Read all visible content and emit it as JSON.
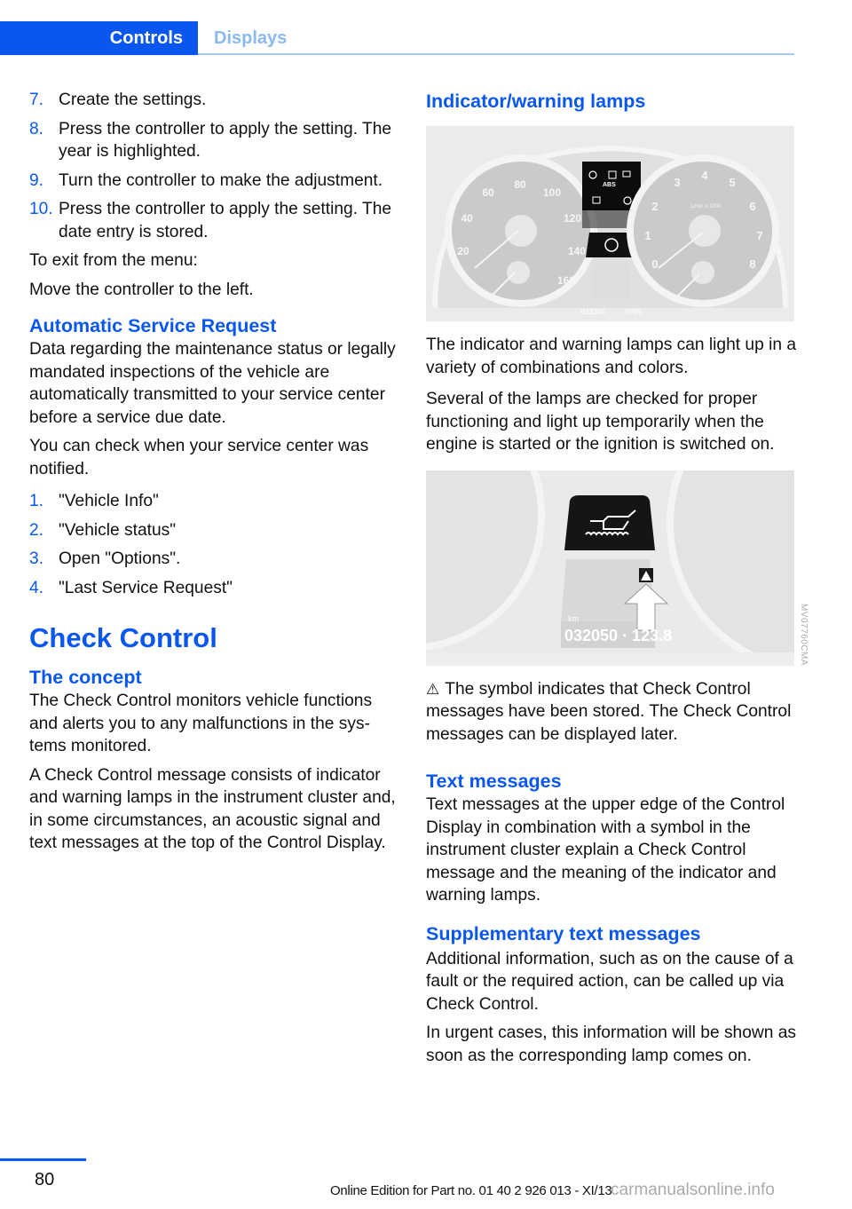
{
  "header": {
    "tabs": [
      {
        "label": "Controls",
        "active": true
      },
      {
        "label": "Displays",
        "active": false
      }
    ]
  },
  "colors": {
    "accent": "#0a57f0",
    "inactive_tab": "#8ab8f0"
  },
  "left": {
    "steps_a": [
      {
        "num": "7.",
        "text": "Create the settings."
      },
      {
        "num": "8.",
        "text": "Press the controller to apply the setting. The year is highlighted."
      },
      {
        "num": "9.",
        "text": "Turn the controller to make the adjust­ment."
      },
      {
        "num": "10.",
        "text": "Press the controller to apply the setting. The date entry is stored."
      }
    ],
    "exit_label": "To exit from the menu:",
    "exit_action": "Move the controller to the left.",
    "asr_heading": "Automatic Service Request",
    "asr_p1": "Data regarding the maintenance status or le­gally mandated inspections of the vehicle are automatically transmitted to your service cen­ter before a service due date.",
    "asr_p2": "You can check when your service center was notified.",
    "steps_b": [
      {
        "num": "1.",
        "text": "\"Vehicle Info\""
      },
      {
        "num": "2.",
        "text": "\"Vehicle status\""
      },
      {
        "num": "3.",
        "text": "Open \"Options\"."
      },
      {
        "num": "4.",
        "text": "\"Last Service Request\""
      }
    ],
    "cc_title": "Check Control",
    "concept_heading": "The concept",
    "concept_p1": "The Check Control monitors vehicle functions and alerts you to any malfunctions in the sys­tems monitored.",
    "concept_p2": "A Check Control message consists of indicator and warning lamps in the instrument cluster and, in some circumstances, an acoustic signal and text messages at the top of the Control Display."
  },
  "right": {
    "lamps_heading": "Indicator/warning lamps",
    "figure1": {
      "speedo_labels": [
        "20",
        "40",
        "60",
        "80",
        "100",
        "120",
        "140",
        "160"
      ],
      "tacho_labels": [
        "0",
        "1",
        "2",
        "3",
        "4",
        "5",
        "6",
        "7",
        "8"
      ],
      "tacho_unit": "1/min x 1000",
      "lamp_text": [
        "ABS"
      ],
      "odometer": "012345",
      "trip": "0789"
    },
    "lamps_p1": "The indicator and warning lamps can light up in a variety of combinations and colors.",
    "lamps_p2": "Several of the lamps are checked for proper functioning and light up temporarily when the engine is started or the ignition is switched on.",
    "figure2": {
      "odometer_unit": "km",
      "odometer": "032050 · 123.8",
      "image_code": "MV07760CMA"
    },
    "symbol_icon": "warning-triangle-icon",
    "symbol_p": "The symbol indicates that Check Control messages have been stored. The Check Con­trol messages can be displayed later.",
    "text_heading": "Text messages",
    "text_p": "Text messages at the upper edge of the Con­trol Display in combination with a symbol in the instrument cluster explain a Check Control message and the meaning of the indicator and warning lamps.",
    "supp_heading": "Supplementary text messages",
    "supp_p1": "Additional information, such as on the cause of a fault or the required action, can be called up via Check Control.",
    "supp_p2": "In urgent cases, this information will be shown as soon as the corresponding lamp comes on."
  },
  "footer": {
    "page_number": "80",
    "edition": "Online Edition for Part no. 01 40 2 926 013 - XI/13",
    "watermark": "carmanualsonline.info"
  }
}
